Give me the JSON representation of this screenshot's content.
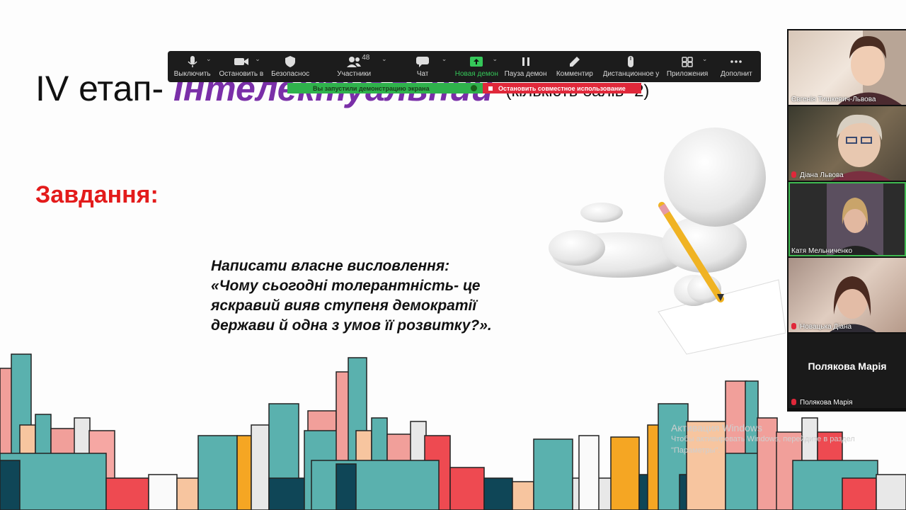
{
  "slide": {
    "title_prefix": "IV етап- ",
    "title_accent": "Інтелектуальний",
    "title_points": "(кількість балів- 2)",
    "task_heading": "Завдання:",
    "task_lines": [
      "Написати власне висловлення:",
      "«Чому сьогодні толерантність- це",
      "яскравий вияв ступеня демократії",
      "держави й одна з умов її розвитку?»."
    ]
  },
  "watermark": {
    "line1": "Активация Windows",
    "line2": "Чтобы активировать Windows, перейдите в раздел",
    "line3": "\"Параметры\"."
  },
  "toolbar": {
    "mute": "Выключить",
    "video": "Остановить в",
    "security": "Безопаснос",
    "participants": "Участники",
    "participants_count": "48",
    "chat": "Чат",
    "new_share": "Новая демон",
    "pause_share": "Пауза демон",
    "annotate": "Комментир",
    "remote_control": "Дистанционное у",
    "apps": "Приложения",
    "more": "Дополнит"
  },
  "share_banner": {
    "status": "Вы запустили демонстрацию экрана",
    "stop": "Остановить совместное использование"
  },
  "participants": [
    {
      "name": "Євгенія Тишкевич-Львова",
      "muted": false
    },
    {
      "name": "Діана Львова",
      "muted": true
    },
    {
      "name": "Катя Мельниченко",
      "muted": false
    },
    {
      "name": "Новацька Діана",
      "muted": true
    },
    {
      "name": "Полякова Марія",
      "muted": true,
      "display_name": "Полякова Марія"
    }
  ],
  "colors": {
    "title_accent": "#7a2fa8",
    "task_heading": "#e31b1b",
    "share_green": "#2fb24c",
    "share_red": "#e0283a"
  }
}
